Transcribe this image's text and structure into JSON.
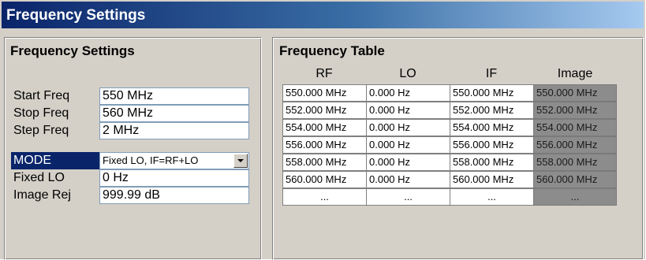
{
  "window": {
    "title": "Frequency Settings"
  },
  "settings_panel": {
    "title": "Frequency Settings",
    "rows": [
      {
        "label": "Start Freq",
        "value": "550 MHz"
      },
      {
        "label": "Stop Freq",
        "value": "560 MHz"
      },
      {
        "label": "Step Freq",
        "value": "2 MHz"
      },
      {
        "label": "MODE",
        "value": "Fixed LO, IF=RF+LO"
      },
      {
        "label": "Fixed LO",
        "value": "0 Hz"
      },
      {
        "label": "Image Rej",
        "value": "999.99 dB"
      }
    ]
  },
  "table_panel": {
    "title": "Frequency Table",
    "columns": [
      "RF",
      "LO",
      "IF",
      "Image"
    ],
    "rows": [
      [
        "550.000 MHz",
        "0.000 Hz",
        "550.000 MHz",
        "550.000 MHz"
      ],
      [
        "552.000 MHz",
        "0.000 Hz",
        "552.000 MHz",
        "552.000 MHz"
      ],
      [
        "554.000 MHz",
        "0.000 Hz",
        "554.000 MHz",
        "554.000 MHz"
      ],
      [
        "556.000 MHz",
        "0.000 Hz",
        "556.000 MHz",
        "556.000 MHz"
      ],
      [
        "558.000 MHz",
        "0.000 Hz",
        "558.000 MHz",
        "558.000 MHz"
      ],
      [
        "560.000 MHz",
        "0.000 Hz",
        "560.000 MHz",
        "560.000 MHz"
      ],
      [
        "...",
        "...",
        "...",
        "..."
      ]
    ]
  }
}
